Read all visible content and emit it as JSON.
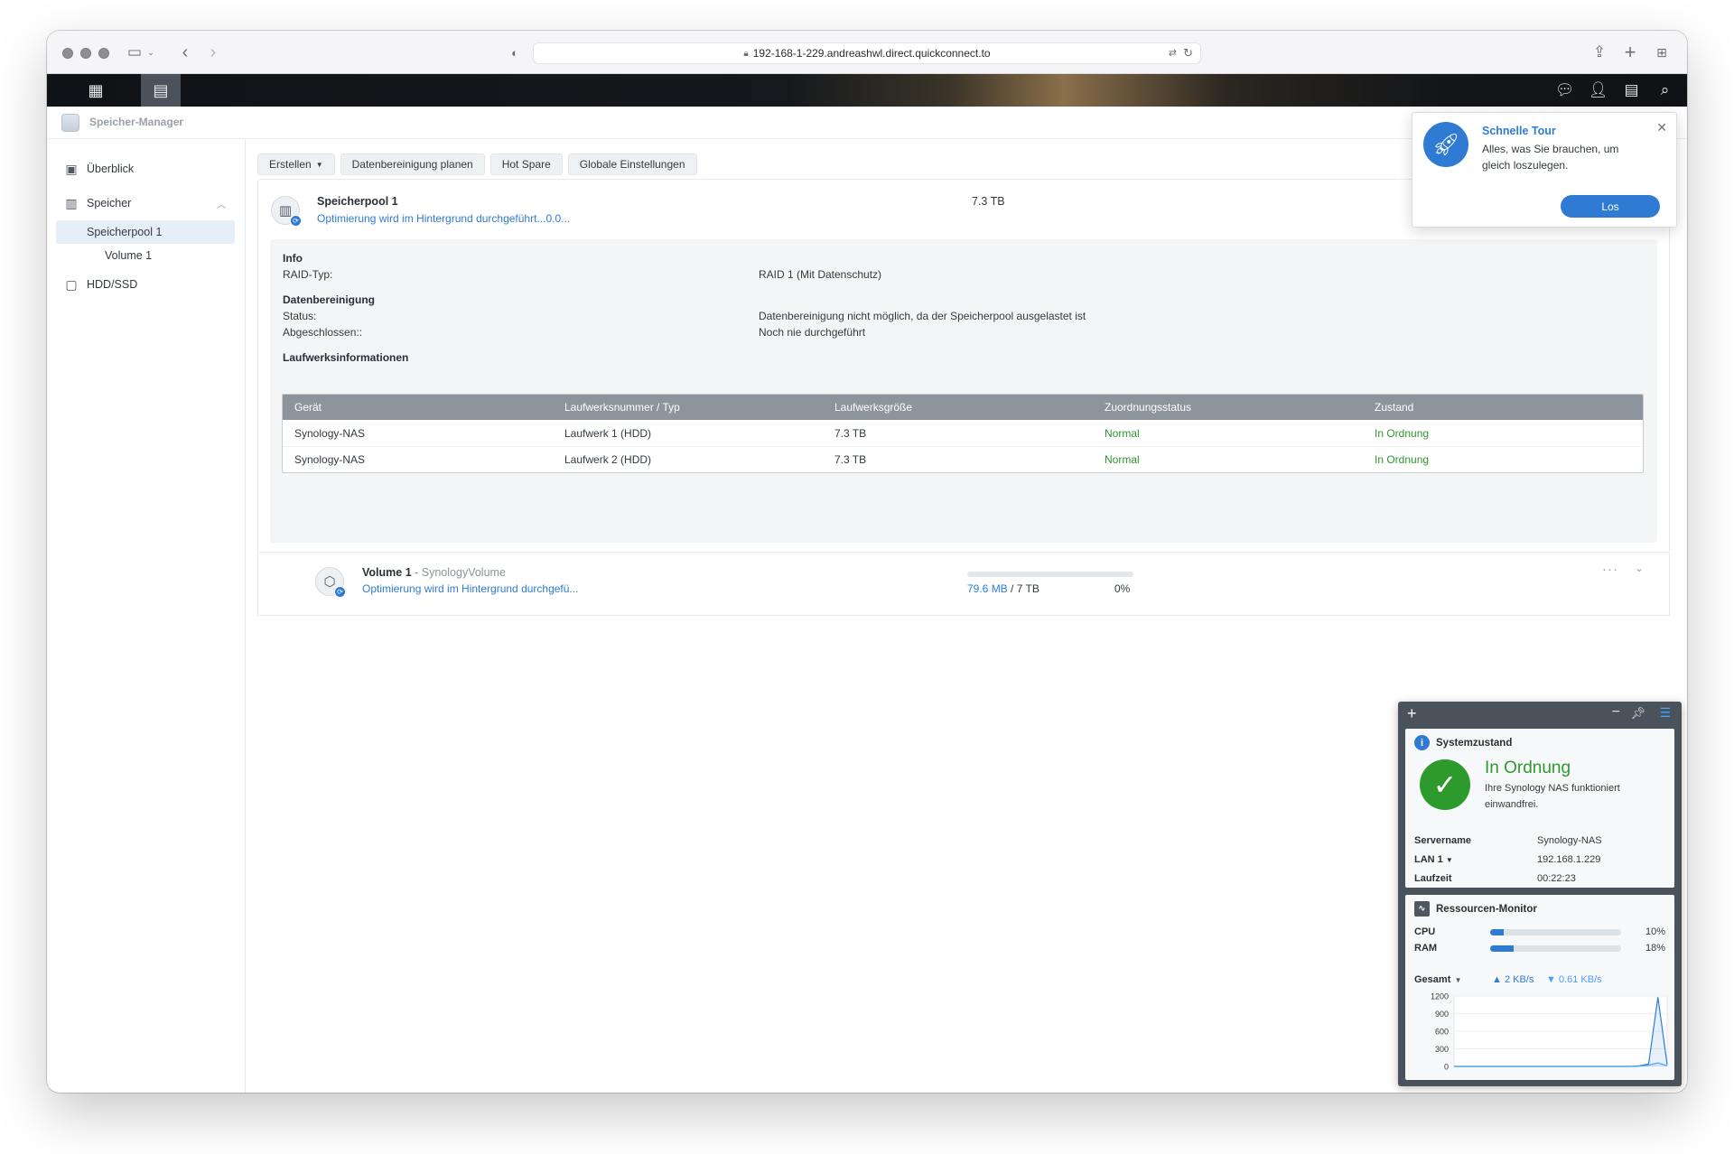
{
  "browser": {
    "url": "192-168-1-229.andreashwl.direct.quickconnect.to",
    "icons": {
      "sidebar": "sidebar-toggle-icon",
      "back": "back-arrow-icon",
      "forward": "forward-arrow-icon",
      "shield": "privacy-shield-icon",
      "lock": "lock-icon",
      "translate": "translate-icon",
      "reload": "reload-icon",
      "share": "share-icon",
      "new_tab": "plus-icon",
      "tab_overview": "tab-overview-icon"
    }
  },
  "dsm": {
    "app_title": "Speicher-Manager",
    "top_icons": [
      "main-menu-icon",
      "storage-manager-app-icon",
      "notifications-icon",
      "user-icon",
      "widgets-icon",
      "search-icon"
    ]
  },
  "sidebar": {
    "overview": "Überblick",
    "storage": "Speicher",
    "pool": "Speicherpool 1",
    "volume": "Volume 1",
    "hdd": "HDD/SSD"
  },
  "toolbar": {
    "create": "Erstellen",
    "scrub_schedule": "Datenbereinigung planen",
    "hot_spare": "Hot Spare",
    "global_settings": "Globale Einstellungen"
  },
  "pool": {
    "name": "Speicherpool 1",
    "status": "Optimierung wird im Hintergrund durchgeführt...0.0...",
    "size": "7.3 TB",
    "info_heading": "Info",
    "raid_label": "RAID-Typ:",
    "raid_value": "RAID 1 (Mit Datenschutz)",
    "scrub_heading": "Datenbereinigung",
    "scrub_status_label": "Status:",
    "scrub_status_value": "Datenbereinigung nicht möglich, da der Speicherpool ausgelastet ist",
    "scrub_done_label": "Abgeschlossen::",
    "scrub_done_value": "Noch nie durchgeführt",
    "drives_heading": "Laufwerksinformationen"
  },
  "drive_table": {
    "columns": [
      "Gerät",
      "Laufwerksnummer / Typ",
      "Laufwerksgröße",
      "Zuordnungsstatus",
      "Zustand"
    ],
    "rows": [
      [
        "Synology-NAS",
        "Laufwerk 1 (HDD)",
        "7.3 TB",
        "Normal",
        "In Ordnung"
      ],
      [
        "Synology-NAS",
        "Laufwerk 2 (HDD)",
        "7.3 TB",
        "Normal",
        "In Ordnung"
      ]
    ]
  },
  "volume": {
    "name": "Volume 1",
    "separator": " - ",
    "description": "SynologyVolume",
    "status": "Optimierung wird im Hintergrund durchgefü...",
    "used": "79.6 MB",
    "total": " / 7 TB",
    "percent_label": "0%",
    "used_fraction": 0.0
  },
  "tour": {
    "title": "Schnelle Tour",
    "text": "Alles, was Sie brauchen, um gleich loszulegen.",
    "button": "Los"
  },
  "widgets": {
    "health": {
      "title": "Systemzustand",
      "status": "In Ordnung",
      "description": "Ihre Synology NAS funktioniert einwandfrei.",
      "server_label": "Servername",
      "server_value": "Synology-NAS",
      "lan_label": "LAN 1",
      "lan_value": "192.168.1.229",
      "uptime_label": "Laufzeit",
      "uptime_value": "00:22:23"
    },
    "resources": {
      "title": "Ressourcen-Monitor",
      "rows": [
        {
          "label": "CPU",
          "percent": 10,
          "text": "10%"
        },
        {
          "label": "RAM",
          "percent": 18,
          "text": "18%"
        }
      ],
      "net_label": "Gesamt",
      "upload": "2 KB/s",
      "download": "0.61 KB/s"
    }
  },
  "colors": {
    "accent": "#2f7bd4",
    "ok": "#2d9a2d",
    "table_header": "#8d949c",
    "widget_panel": "#4a525b"
  },
  "chart_data": {
    "type": "area",
    "title": "",
    "xlabel": "",
    "ylabel": "",
    "ylim": [
      0,
      1200
    ],
    "yticks": [
      1200,
      900,
      600,
      300,
      0
    ],
    "grid": true,
    "series": [
      {
        "values": [
          0,
          0,
          0,
          0,
          0,
          0,
          0,
          0,
          0,
          0,
          0,
          0,
          0,
          0,
          0,
          0,
          0,
          0,
          0,
          0,
          10,
          40,
          1180,
          30
        ]
      },
      {
        "values": [
          0,
          0,
          0,
          0,
          0,
          0,
          0,
          0,
          0,
          0,
          0,
          0,
          0,
          0,
          0,
          0,
          0,
          0,
          0,
          0,
          5,
          20,
          60,
          10
        ]
      }
    ]
  }
}
